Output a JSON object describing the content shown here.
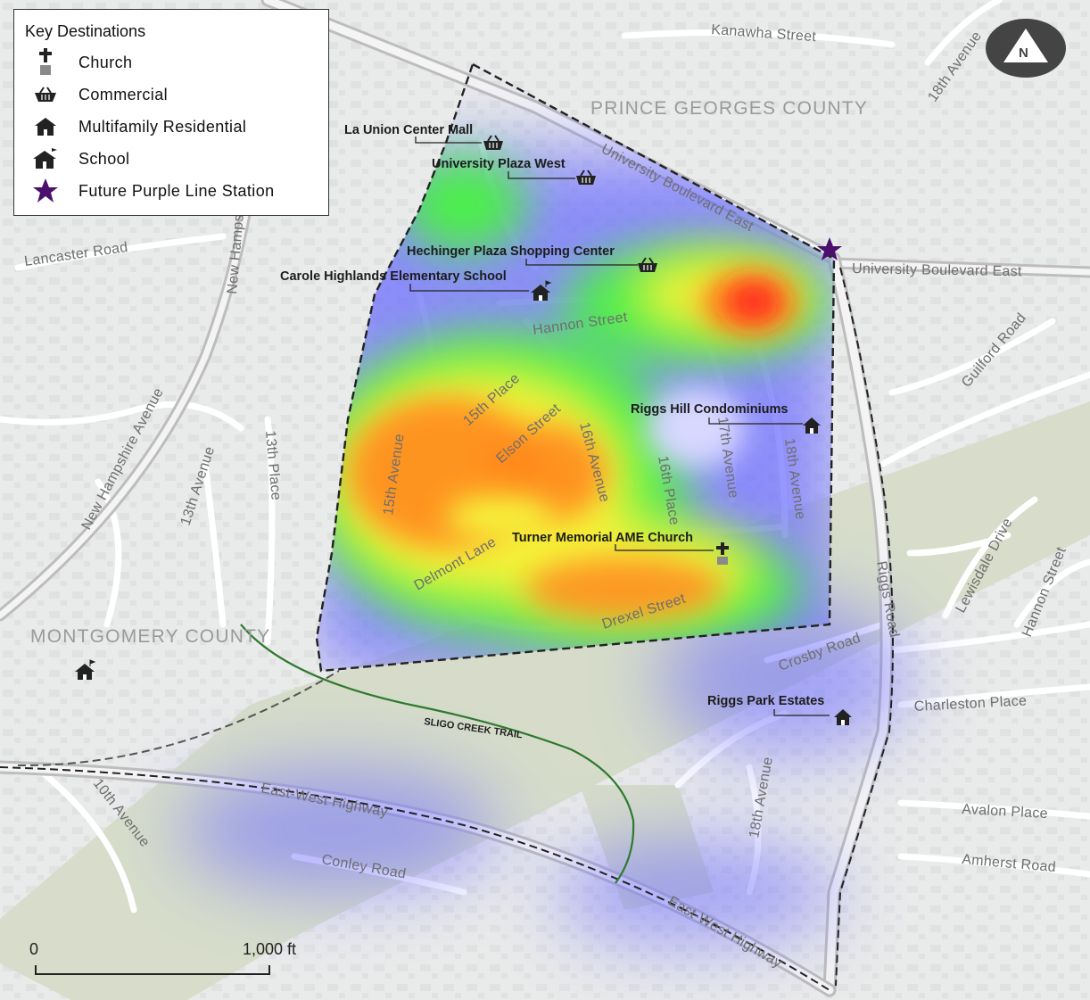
{
  "legend": {
    "title": "Key Destinations",
    "items": [
      {
        "label": "Church",
        "icon": "church-icon"
      },
      {
        "label": "Commercial",
        "icon": "basket-icon"
      },
      {
        "label": "Multifamily Residential",
        "icon": "house-icon"
      },
      {
        "label": "School",
        "icon": "school-icon"
      },
      {
        "label": "Future Purple Line Station",
        "icon": "star-icon"
      }
    ]
  },
  "counties": {
    "prince_georges": "PRINCE GEORGES COUNTY",
    "montgomery": "MONTGOMERY COUNTY"
  },
  "streets": {
    "kanawha": "Kanawha Street",
    "eighteenth_ne": "18th Avenue",
    "university_diag": "University Boulevard East",
    "university_east": "University Boulevard East",
    "lancaster": "Lancaster Road",
    "new_hampshire_top": "New Hampsh",
    "hannon": "Hannon Street",
    "guilford": "Guilford Road",
    "fifteenth_place": "15th Place",
    "elson": "Elson Street",
    "sixteenth_ave": "16th Avenue",
    "sixteenth_place": "16th Place",
    "seventeenth_ave": "17th Avenue",
    "eighteenth_ave": "18th Avenue",
    "fifteenth_ave": "15th Avenue",
    "thirteenth_place": "13th Place",
    "thirteenth_ave": "13th Avenue",
    "new_hampshire": "New Hampshire Avenue",
    "delmont": "Delmont Lane",
    "drexel": "Drexel Street",
    "riggs": "Riggs Road",
    "crosby": "Crosby Road",
    "lewisdale": "Lewisdale Drive",
    "hannon_east": "Hannon Street",
    "charleston": "Charleston Place",
    "tenth_ave": "10th Avenue",
    "east_west_1": "East-West Highway",
    "east_west_2": "East-West Highway",
    "conley": "Conley Road",
    "eighteenth_south": "18th Avenue",
    "avalon": "Avalon Place",
    "amherst": "Amherst Road"
  },
  "trail": "SLIGO CREEK TRAIL",
  "destinations": {
    "la_union": "La Union Center Mall",
    "university_plaza": "University Plaza West",
    "hechinger": "Hechinger Plaza Shopping Center",
    "carole_highlands": "Carole Highlands Elementary School",
    "riggs_hill": "Riggs Hill Condominiums",
    "turner": "Turner Memorial AME Church",
    "riggs_park": "Riggs Park Estates"
  },
  "scale": {
    "start": "0",
    "end": "1,000 ft"
  },
  "north_label": "N",
  "colors": {
    "heat_red": "#ff2020",
    "heat_orange": "#ff8a1e",
    "heat_yellow": "#f6f23a",
    "heat_green": "#4cf04a",
    "heat_blue": "#6c6cff",
    "station_purple": "#4b0f6e",
    "trail_green": "#2f7a2f",
    "map_bg": "#e9eaea",
    "parkland": "#d8dfcb"
  }
}
